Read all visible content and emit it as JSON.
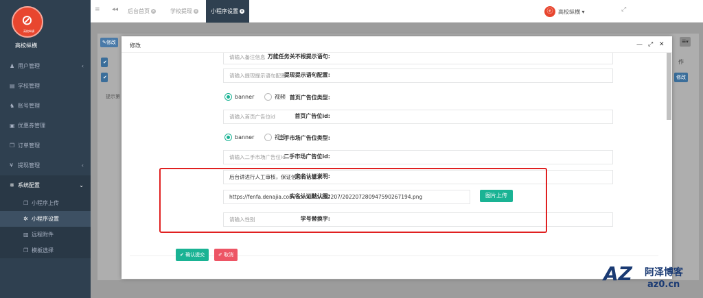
{
  "brand": {
    "name": "高校纵横",
    "logo_small": "高校纵横"
  },
  "sidebar": {
    "items": [
      {
        "icon": "user-icon",
        "glyph": "♟",
        "label": "用户管理",
        "arrow": "‹"
      },
      {
        "icon": "book-icon",
        "glyph": "▤",
        "label": "学校管理"
      },
      {
        "icon": "users-icon",
        "glyph": "♞",
        "label": "账号管理"
      },
      {
        "icon": "coupon-icon",
        "glyph": "▣",
        "label": "优惠券管理"
      },
      {
        "icon": "copy-icon",
        "glyph": "❐",
        "label": "订单管理"
      },
      {
        "icon": "yen-icon",
        "glyph": "¥",
        "label": "提现管理",
        "arrow": "‹"
      },
      {
        "icon": "gear-icon",
        "glyph": "✲",
        "label": "系统配置",
        "arrow": "⌄"
      }
    ],
    "sub_items": [
      {
        "icon": "copy-icon",
        "glyph": "❐",
        "label": "小程序上传"
      },
      {
        "icon": "gear-icon",
        "glyph": "✲",
        "label": "小程序设置"
      },
      {
        "icon": "file-icon",
        "glyph": "▥",
        "label": "远程附件"
      },
      {
        "icon": "copy-icon",
        "glyph": "❐",
        "label": "模板选择"
      }
    ]
  },
  "topbar": {
    "menu_glyph": "≡",
    "back_glyph": "◂◂",
    "tabs": [
      "后台首页",
      "学校提现",
      "小程序设置"
    ],
    "expand_glyph": "⤢",
    "user_name": "高校纵横 ▾",
    "avatar_glyph": "ⓔ"
  },
  "background": {
    "edit_btn": "✎修改",
    "op_col": "作",
    "edit_small": "修改",
    "hint": "提示第",
    "menu_btn": "☰▾"
  },
  "modal": {
    "title": "修改",
    "ctrl_min": "—",
    "ctrl_max": "⤢",
    "ctrl_close": "✕",
    "rows": [
      {
        "label": "万能任务关不根提示语句:",
        "placeholder": "请输入备注信息"
      },
      {
        "label": "提现提示语句配置:",
        "placeholder": "请输入提现提示语句配置"
      },
      {
        "label": "首页广告位类型:",
        "radio": [
          "banner",
          "视频"
        ]
      },
      {
        "label": "首页广告位id:",
        "placeholder": "请输入首页广告位id"
      },
      {
        "label": "二手市场广告位类型:",
        "radio": [
          "banner",
          "视频"
        ]
      },
      {
        "label": "二手市场广告位id:",
        "placeholder": "请输入二手市场广告位id"
      },
      {
        "label": "实名认证说明:",
        "value": "后台讲进行人工审核，保证信息符合要求"
      },
      {
        "label": "实名认证默认图:",
        "value": "https://fenfa.denajia.com/accounts/202207/20220728094759026719​4.png"
      },
      {
        "label": "学号替换字:",
        "placeholder": "请输入性别"
      }
    ],
    "upload_label": "图片上传",
    "submit_label": "✔ 确认提交",
    "cancel_label": "✐ 取消"
  },
  "watermark": {
    "az": "AZ",
    "cn": "阿泽博客",
    "url": "az0.cn"
  },
  "colors": {
    "sidebar": "#2f4050",
    "accent": "#1ab394",
    "danger": "#ed5565",
    "highlight": "#e02020"
  }
}
